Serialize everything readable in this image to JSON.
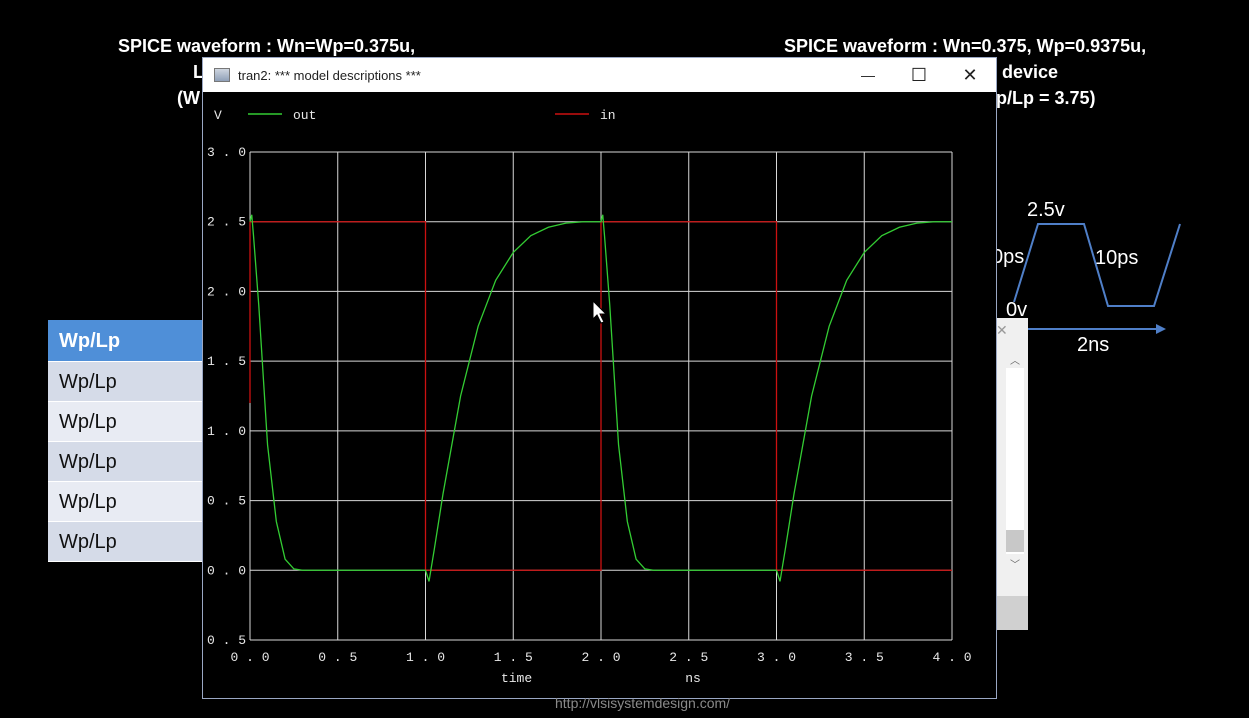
{
  "slide": {
    "title_left_line1": "SPICE waveform : Wn=Wp=0.375u,",
    "title_left_line2_frag": "L",
    "title_left_line3_frag": "(W",
    "title_right_line1": "SPICE waveform : Wn=0.375, Wp=0.9375u,",
    "title_right_line2_frag": "device",
    "title_right_line3_frag": "p/Lp = 3.75)",
    "table_rows": [
      "Wp/Lp",
      "Wp/Lp",
      "Wp/Lp",
      "Wp/Lp",
      "Wp/Lp",
      "Wp/Lp"
    ],
    "pulse": {
      "high": "2.5v",
      "rise_frag": "0ps",
      "fall": "10ps",
      "low": "0v",
      "period": "2ns"
    },
    "url": "http://vlsisystemdesign.com/"
  },
  "window": {
    "title": "tran2: *** model descriptions ***",
    "minimize": "—",
    "maximize": "☐",
    "close": "✕"
  },
  "chart_data": {
    "type": "line",
    "y_unit": "V",
    "xlabel": "time",
    "x_unit": "ns",
    "xlim": [
      0,
      4
    ],
    "ylim": [
      -0.5,
      3
    ],
    "xticks": [
      "0.0",
      "0.5",
      "1.0",
      "1.5",
      "2.0",
      "2.5",
      "3.0",
      "3.5",
      "4.0"
    ],
    "yticks": [
      "3.0",
      "2.5",
      "2.0",
      "1.5",
      "1.0",
      "0.5",
      "0.0",
      "-0.5"
    ],
    "grid": true,
    "legend_position": "top",
    "series": [
      {
        "name": "out",
        "color": "#33cc33",
        "x": [
          0.0,
          0.01,
          0.02,
          0.05,
          0.1,
          0.15,
          0.2,
          0.25,
          0.3,
          1.0,
          1.02,
          1.05,
          1.1,
          1.2,
          1.3,
          1.4,
          1.5,
          1.6,
          1.7,
          1.8,
          1.9,
          2.0,
          2.01,
          2.02,
          2.05,
          2.1,
          2.15,
          2.2,
          2.25,
          2.3,
          3.0,
          3.02,
          3.05,
          3.1,
          3.2,
          3.3,
          3.4,
          3.5,
          3.6,
          3.7,
          3.8,
          3.9,
          4.0
        ],
        "y": [
          2.5,
          2.55,
          2.4,
          1.9,
          0.9,
          0.35,
          0.08,
          0.01,
          0.0,
          0.0,
          -0.08,
          0.15,
          0.55,
          1.25,
          1.75,
          2.08,
          2.28,
          2.4,
          2.46,
          2.49,
          2.5,
          2.5,
          2.55,
          2.4,
          1.9,
          0.9,
          0.35,
          0.08,
          0.01,
          0.0,
          0.0,
          -0.08,
          0.15,
          0.55,
          1.25,
          1.75,
          2.08,
          2.28,
          2.4,
          2.46,
          2.49,
          2.5,
          2.5
        ]
      },
      {
        "name": "in",
        "color": "#cc1111",
        "x": [
          0.0,
          0.0,
          1.0,
          1.0,
          2.0,
          2.0,
          3.0,
          3.0,
          4.0
        ],
        "y": [
          1.2,
          2.5,
          2.5,
          0.0,
          0.0,
          2.5,
          2.5,
          0.0,
          0.0
        ]
      }
    ]
  }
}
